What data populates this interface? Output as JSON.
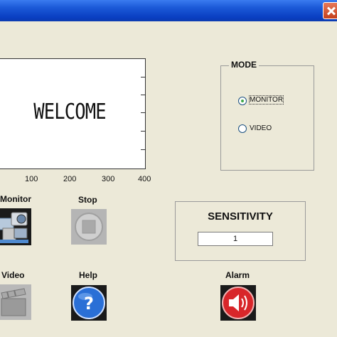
{
  "display": {
    "welcome_text": "WELCOME",
    "x_ticks": [
      "100",
      "200",
      "300",
      "400"
    ]
  },
  "mode": {
    "title": "MODE",
    "options": [
      {
        "label": "MONITOR",
        "selected": true
      },
      {
        "label": "VIDEO",
        "selected": false
      }
    ]
  },
  "sensitivity": {
    "title": "SENSITIVITY",
    "value": "1"
  },
  "buttons": {
    "monitor_label": "Monitor",
    "stop_label": "Stop",
    "video_label": "Video",
    "help_label": "Help",
    "alarm_label": "Alarm"
  },
  "icons": {
    "monitor": "camera-monitor-icon",
    "stop": "stop-icon",
    "video": "video-clapper-icon",
    "help": "help-icon",
    "alarm": "alarm-speaker-icon"
  },
  "colors": {
    "titlebar": "#0a3fc2",
    "background": "#ece9d8",
    "help_blue": "#2a6fd6",
    "alarm_red": "#d8262a",
    "radio_checked": "#3fa84a"
  }
}
